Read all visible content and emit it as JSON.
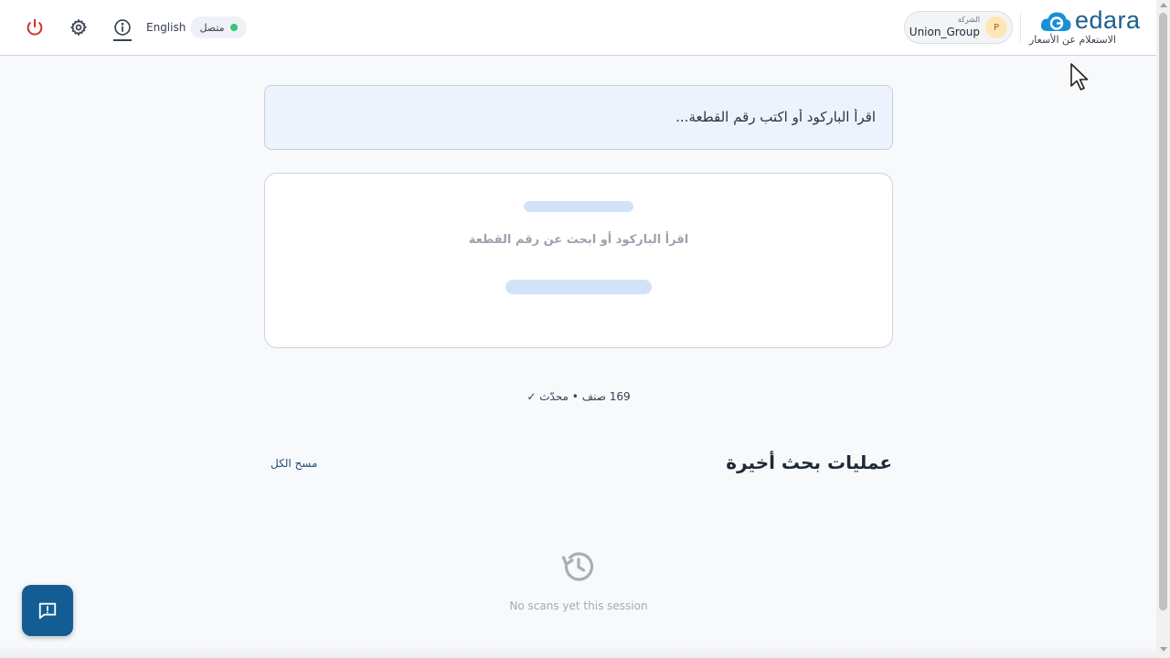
{
  "header": {
    "language_label": "English",
    "status_label": "متصل",
    "status_color": "#34c77b",
    "icons": [
      "power-icon",
      "gear-icon",
      "info-icon"
    ],
    "company": {
      "caption": "الشركة",
      "name": "Union_Group",
      "avatar_letter": "P"
    },
    "brand": {
      "wordmark": "edara",
      "subtitle": "الاستعلام عن الأسعار",
      "color": "#1a5f8e"
    }
  },
  "search": {
    "placeholder": "اقرأ الباركود أو اكتب رقم القطعة...",
    "value": ""
  },
  "result_card": {
    "hint": "اقرأ الباركود أو ابحث عن رقم القطعة"
  },
  "stats": {
    "text": "169 صنف • محدّث ✓"
  },
  "recent": {
    "title": "عمليات بحث أخيرة",
    "clear_all": "مسح الكل",
    "empty_text": "No scans yet this session"
  },
  "colors": {
    "accent": "#145d94",
    "danger": "#d32f2f"
  }
}
